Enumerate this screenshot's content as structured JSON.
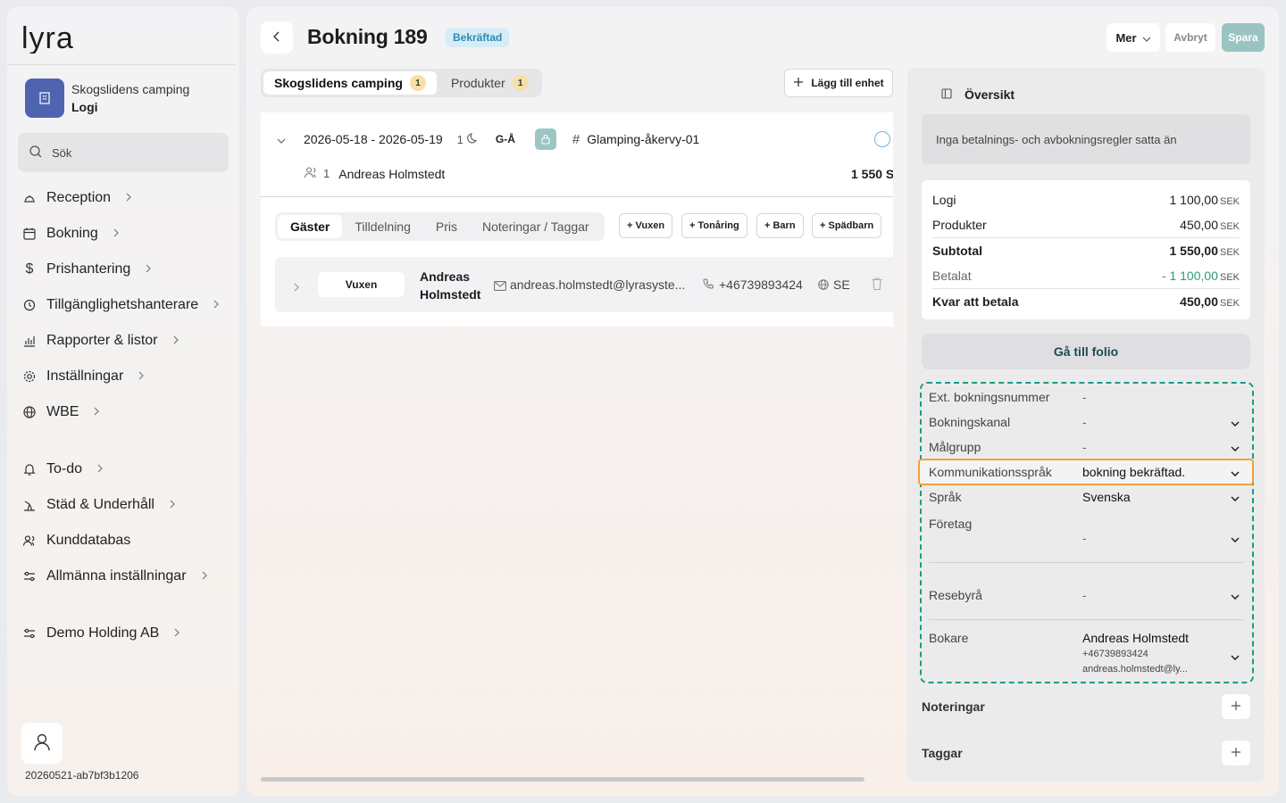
{
  "brand": {
    "logo_text": "lyra"
  },
  "sidebar": {
    "property_name": "Skogslidens camping",
    "property_sub": "Logi",
    "search_placeholder": "Sök",
    "nav": [
      {
        "label": "Reception",
        "icon": "bell-desk-icon"
      },
      {
        "label": "Bokning",
        "icon": "calendar-icon"
      },
      {
        "label": "Prishantering",
        "icon": "dollar-icon"
      },
      {
        "label": "Tillgänglighetshanterare",
        "icon": "history-icon"
      },
      {
        "label": "Rapporter & listor",
        "icon": "chart-icon"
      },
      {
        "label": "Inställningar",
        "icon": "gear-icon"
      },
      {
        "label": "WBE",
        "icon": "globe-icon"
      },
      {
        "label": "To-do",
        "icon": "bell-icon"
      },
      {
        "label": "Städ & Underhåll",
        "icon": "broom-icon"
      },
      {
        "label": "Kunddatabas",
        "icon": "users-icon"
      },
      {
        "label": "Allmänna inställningar",
        "icon": "sliders-icon"
      },
      {
        "label": "Demo Holding AB",
        "icon": "sliders-icon"
      }
    ],
    "build_id": "20260521-ab7bf3b1206"
  },
  "header": {
    "title": "Bokning 189",
    "status": "Bekräftad",
    "more_label": "Mer",
    "cancel_label": "Avbryt",
    "save_label": "Spara",
    "colors": {
      "save_bg": "#9ac4c2",
      "status_bg": "#d7ecf6"
    }
  },
  "tabs": [
    {
      "label": "Skogslidens camping",
      "count": "1"
    },
    {
      "label": "Produkter",
      "count": "1"
    }
  ],
  "add_unit_label": "Lägg till enhet",
  "unit": {
    "dates": "2026-05-18 - 2026-05-19",
    "nights": "1",
    "code": "G-Å",
    "unit_name": "Glamping-åkervy-01",
    "guest_count": "1",
    "guest_name": "Andreas Holmstedt",
    "price": "1 550 S"
  },
  "guest_tabs": [
    "Gäster",
    "Tilldelning",
    "Pris",
    "Noteringar / Taggar"
  ],
  "add_guest_buttons": [
    "+ Vuxen",
    "+ Tonåring",
    "+ Barn",
    "+ Spädbarn"
  ],
  "guest": {
    "type": "Vuxen",
    "first_name": "Andreas",
    "last_name": "Holmstedt",
    "email": "andreas.holmstedt@lyrasyste...",
    "phone": "+46739893424",
    "country": "SE"
  },
  "overview": {
    "title": "Översikt",
    "rules_note": "Inga betalnings- och avbokningsregler satta än",
    "summary": [
      {
        "label": "Logi",
        "value": "1 100,00",
        "unit": "SEK"
      },
      {
        "label": "Produkter",
        "value": "450,00",
        "unit": "SEK"
      },
      {
        "label": "Subtotal",
        "value": "1 550,00",
        "unit": "SEK"
      },
      {
        "label": "Betalat",
        "value": "- 1 100,00",
        "unit": "SEK"
      },
      {
        "label": "Kvar att betala",
        "value": "450,00",
        "unit": "SEK"
      }
    ],
    "folio_button": "Gå till folio",
    "fields": [
      {
        "label": "Ext. bokningsnummer",
        "value": "-"
      },
      {
        "label": "Bokningskanal",
        "value": "-"
      },
      {
        "label": "Målgrupp",
        "value": "-"
      },
      {
        "label": "Kommunikationsspråk",
        "value": "bokning bekräftad."
      },
      {
        "label": "Språk",
        "value": "Svenska"
      },
      {
        "label": "Företag",
        "value": "-"
      },
      {
        "label": "Resebyrå",
        "value": "-"
      },
      {
        "label": "Bokare",
        "value": "Andreas Holmstedt",
        "phone": "+46739893424",
        "email": "andreas.holmstedt@ly..."
      }
    ],
    "notes_label": "Noteringar",
    "tags_label": "Taggar"
  }
}
